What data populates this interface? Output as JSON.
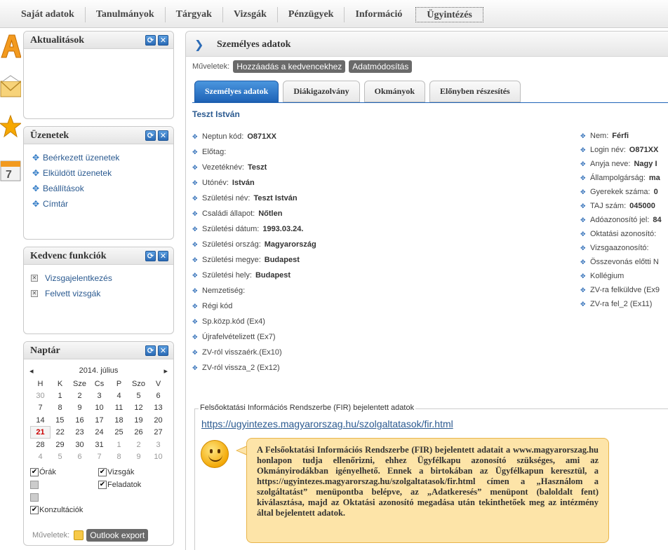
{
  "nav": {
    "items": [
      "Saját adatok",
      "Tanulmányok",
      "Tárgyak",
      "Vizsgák",
      "Pénzügyek",
      "Információ",
      "Ügyintézés"
    ],
    "active_index": 6
  },
  "panels": {
    "aktualitasok": {
      "title": "Aktualitások"
    },
    "uzenetek": {
      "title": "Üzenetek",
      "links": [
        "Beérkezett üzenetek",
        "Elküldött üzenetek",
        "Beállítások",
        "Címtár"
      ]
    },
    "kedvenc": {
      "title": "Kedvenc funkciók",
      "links": [
        "Vizsgajelentkezés",
        "Felvett vizsgák"
      ]
    },
    "naptar": {
      "title": "Naptár",
      "month": "2014. július",
      "prev": "◂",
      "next": "▸",
      "weekdays": [
        "H",
        "K",
        "Sze",
        "Cs",
        "P",
        "Szo",
        "V"
      ],
      "weeks": [
        [
          "30",
          "1",
          "2",
          "3",
          "4",
          "5",
          "6"
        ],
        [
          "7",
          "8",
          "9",
          "10",
          "11",
          "12",
          "13"
        ],
        [
          "14",
          "15",
          "16",
          "17",
          "18",
          "19",
          "20"
        ],
        [
          "21",
          "22",
          "23",
          "24",
          "25",
          "26",
          "27"
        ],
        [
          "28",
          "29",
          "30",
          "31",
          "1",
          "2",
          "3"
        ],
        [
          "4",
          "5",
          "6",
          "7",
          "8",
          "9",
          "10"
        ]
      ],
      "today": "21",
      "checks": {
        "orak": "Órák",
        "vizsgak": "Vizsgák",
        "feladatok": "Feladatok",
        "konzultaciok": "Konzultációk"
      },
      "ops_label": "Műveletek:",
      "export_label": "Outlook export"
    }
  },
  "main": {
    "title": "Személyes adatok",
    "ops_label": "Műveletek:",
    "ops_buttons": [
      "Hozzáadás a kedvencekhez",
      "Adatmódosítás"
    ],
    "tabs": [
      "Személyes adatok",
      "Diákigazolvány",
      "Okmányok",
      "Előnyben részesítés"
    ],
    "person_name": "Teszt István",
    "left_fields": [
      {
        "label": "Neptun kód:",
        "value": "O871XX"
      },
      {
        "label": "Előtag:",
        "value": ""
      },
      {
        "label": "Vezetéknév:",
        "value": "Teszt"
      },
      {
        "label": "Utónév:",
        "value": "István"
      },
      {
        "label": "Születési név:",
        "value": "Teszt István"
      },
      {
        "label": "Családi állapot:",
        "value": "Nőtlen"
      },
      {
        "label": "Születési dátum:",
        "value": "1993.03.24."
      },
      {
        "label": "Születési ország:",
        "value": "Magyarország"
      },
      {
        "label": "Születési megye:",
        "value": "Budapest"
      },
      {
        "label": "Születési hely:",
        "value": "Budapest"
      },
      {
        "label": "Nemzetiség:",
        "value": ""
      },
      {
        "label": "Régi kód",
        "value": ""
      },
      {
        "label": "Sp.közp.kód (Ex4)",
        "value": ""
      },
      {
        "label": "Újrafelvételizett (Ex7)",
        "value": ""
      },
      {
        "label": "ZV-ról visszaérk.(Ex10)",
        "value": ""
      },
      {
        "label": "ZV-ról vissza_2 (Ex12)",
        "value": ""
      }
    ],
    "right_fields": [
      {
        "label": "Nem:",
        "value": "Férfi"
      },
      {
        "label": "Login név:",
        "value": "O871XX"
      },
      {
        "label": "Anyja neve:",
        "value": "Nagy I"
      },
      {
        "label": "Állampolgárság:",
        "value": "ma"
      },
      {
        "label": "Gyerekek száma:",
        "value": "0"
      },
      {
        "label": "TAJ szám:",
        "value": "045000"
      },
      {
        "label": "Adóazonosító jel:",
        "value": "84"
      },
      {
        "label": "Oktatási azonosító:",
        "value": ""
      },
      {
        "label": "Vizsgaazonosító:",
        "value": ""
      },
      {
        "label": "Összevonás előtti N",
        "value": ""
      },
      {
        "label": "Kollégium",
        "value": ""
      },
      {
        "label": "ZV-ra felküldve (Ex9",
        "value": ""
      },
      {
        "label": "ZV-ra fel_2 (Ex11)",
        "value": ""
      }
    ],
    "fir": {
      "legend": "Felsőoktatási Információs Rendszerbe (FIR) bejelentett adatok",
      "link": "https://ugyintezes.magyarorszag.hu/szolgaltatasok/fir.html",
      "info": "A Felsőoktatási Információs Rendszerbe (FIR) bejelentett adatait a www.magyarorszag.hu honlapon tudja ellenőrizni, ehhez Ügyfélkapu azonosító szükséges, ami az Okmányirodákban igényelhető. Ennek a birtokában az Ügyfélkapun keresztül, a https://ugyintezes.magyarorszag.hu/szolgaltatasok/fir.html címen a „Használom a szolgáltatást” menüpontba belépve, az „Adatkeresés” menüpont (baloldalt fent) kiválasztása, majd az Oktatási azonosító megadása után tekinthetőek meg az intézmény által bejelentett adatok."
    }
  }
}
